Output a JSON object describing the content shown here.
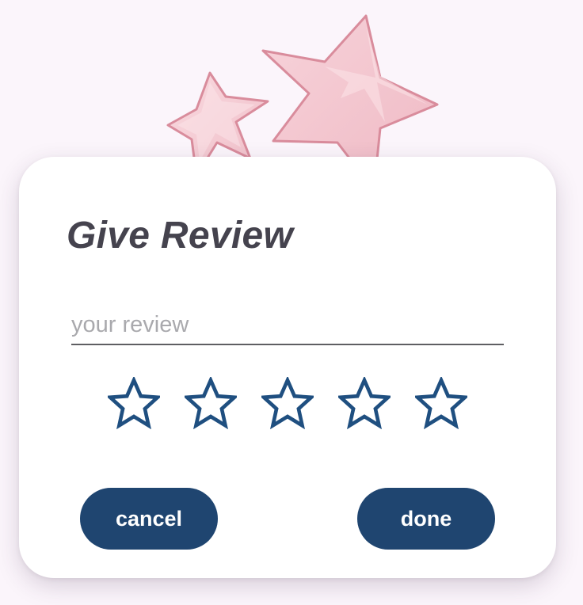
{
  "dialog": {
    "title": "Give Review",
    "review_input": {
      "value": "",
      "placeholder": "your review"
    },
    "rating": {
      "max": 5,
      "value": 0,
      "star_icon": "star-outline-icon",
      "star_color": "#1f4f80"
    },
    "cancel_label": "cancel",
    "done_label": "done"
  },
  "decoration": {
    "icon": "pink-stars-illustration",
    "color": "#f4c9d2"
  },
  "colors": {
    "background": "#fbf5fb",
    "card": "#ffffff",
    "title": "#45434e",
    "button": "#1f4570"
  }
}
